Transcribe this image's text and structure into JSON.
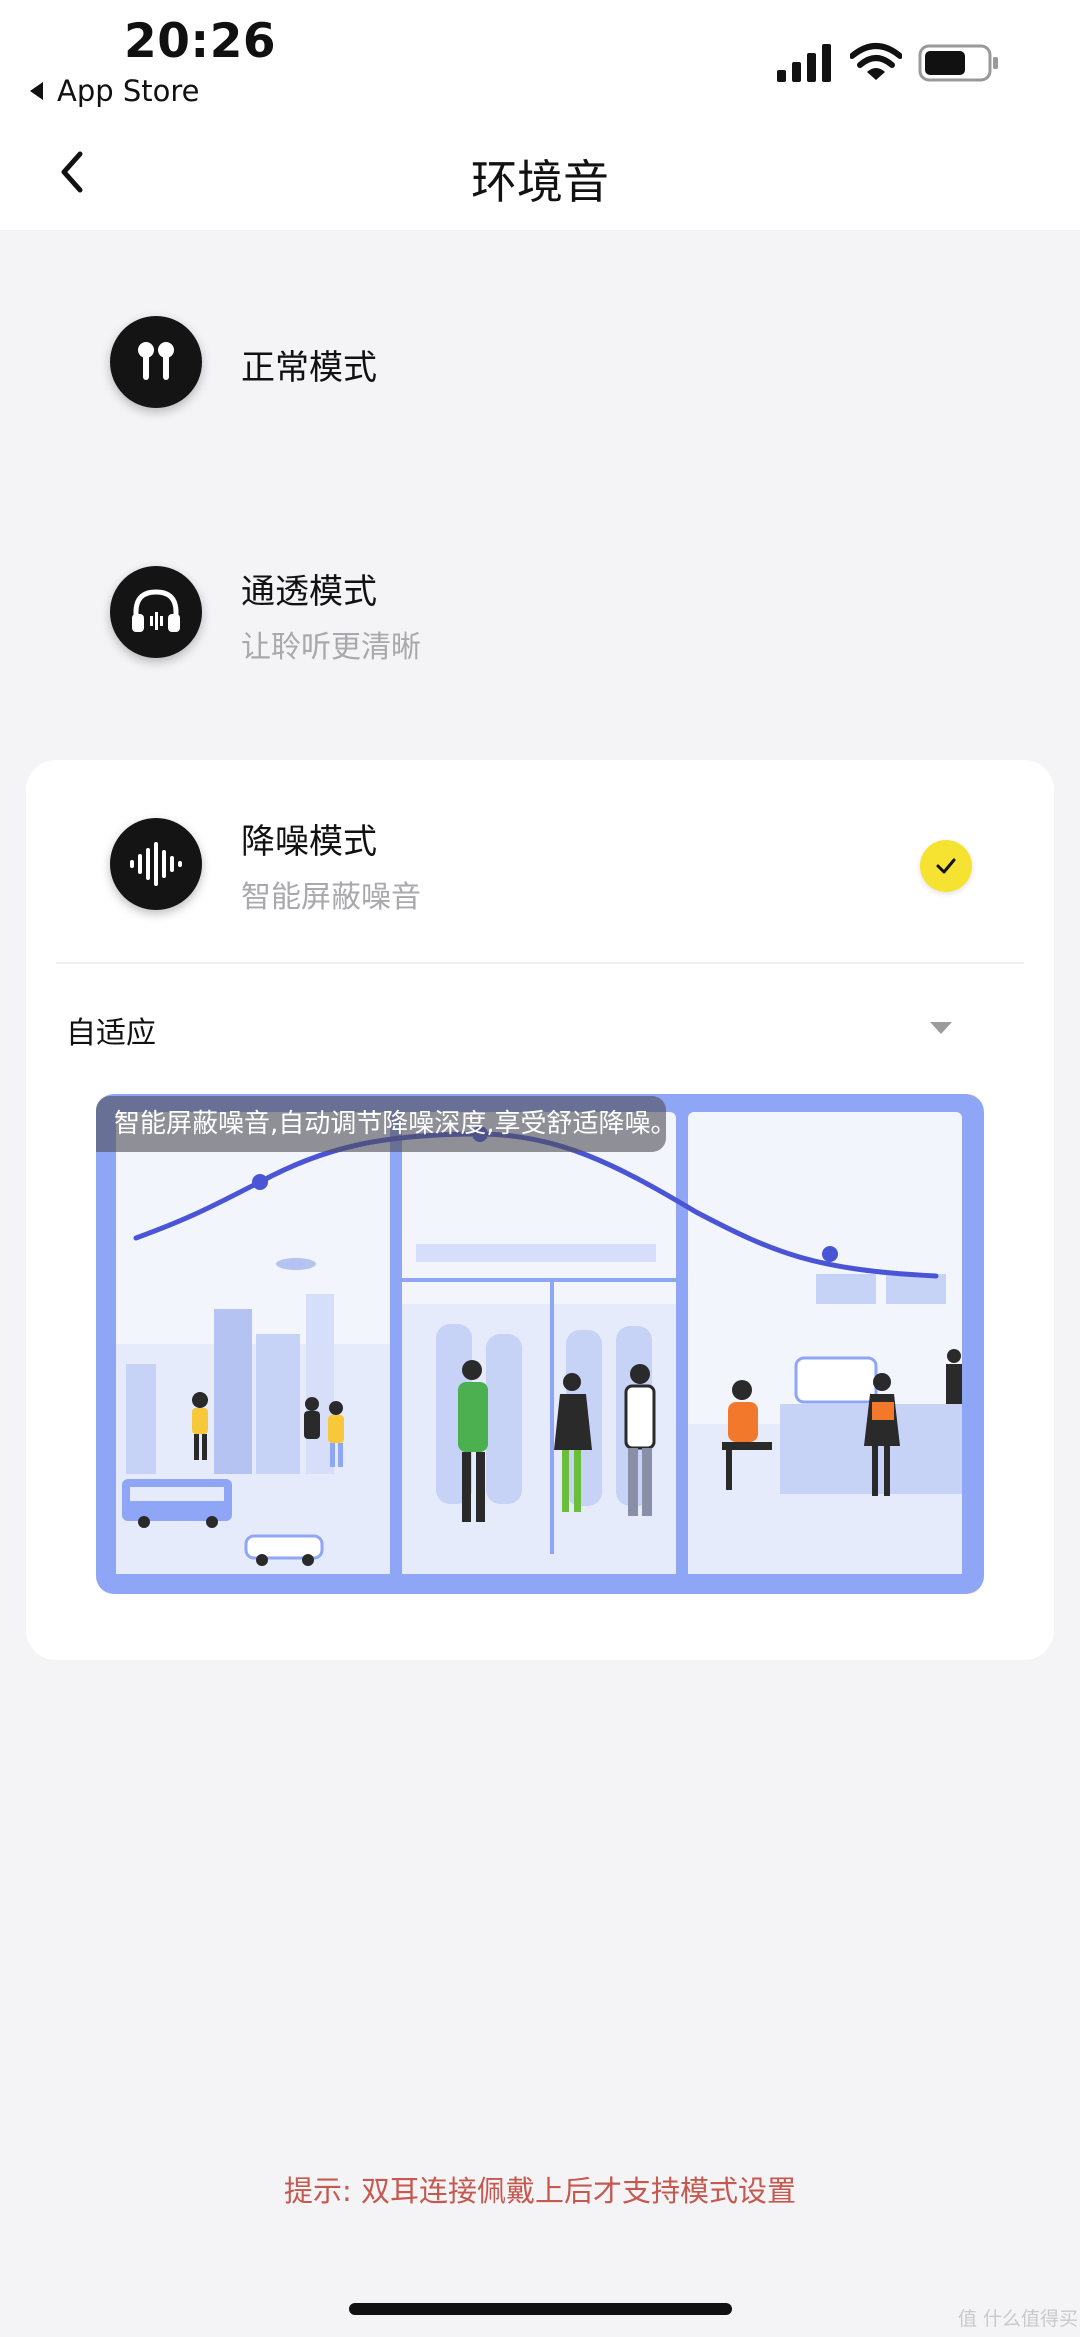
{
  "status_bar": {
    "time": "20:26",
    "back_app": "App Store",
    "icons": [
      "signal-icon",
      "wifi-icon",
      "battery-icon"
    ]
  },
  "nav": {
    "title": "环境音",
    "back_icon": "chevron-left-icon"
  },
  "modes": [
    {
      "title": "正常模式",
      "subtitle": "",
      "icon": "earbuds-icon",
      "selected": false
    },
    {
      "title": "通透模式",
      "subtitle": "让聆听更清晰",
      "icon": "headphones-icon",
      "selected": false
    },
    {
      "title": "降噪模式",
      "subtitle": "智能屏蔽噪音",
      "icon": "soundwave-icon",
      "selected": true
    }
  ],
  "noise_setting": {
    "selected_option": "自适应",
    "description": "智能屏蔽噪音,自动调节降噪深度,享受舒适降噪。"
  },
  "hint": "提示: 双耳连接佩戴上后才支持模式设置",
  "watermark": "值 什么值得买",
  "colors": {
    "accent_yellow": "#f6e331",
    "hint_red": "#c6594f",
    "curve_blue": "#4a55d6",
    "illustration_bg": "#8ea6f5"
  }
}
